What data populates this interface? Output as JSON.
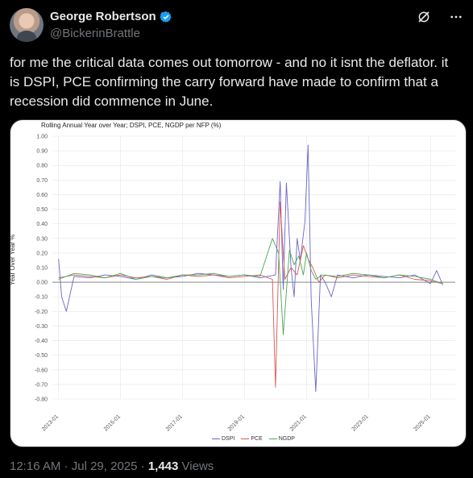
{
  "author": {
    "display_name": "George Robertson",
    "handle": "@BickerinBrattle",
    "avatar_icon": "user-avatar"
  },
  "tweet": {
    "text": "for me the critical data comes out tomorrow - and no it isnt the deflator. it is DSPI, PCE confirming the carry forward have made to confirm that a recession did commence in June."
  },
  "footer": {
    "time": "12:16 AM",
    "date": "Jul 29, 2025",
    "views_count": "1,443",
    "views_label": "Views"
  },
  "colors": {
    "dspi": "#6b64c9",
    "pce": "#d9574f",
    "ngdp": "#4aa85a",
    "verified": "#1d9bf0"
  },
  "chart_data": {
    "type": "line",
    "title": "Rolling Annual Year over Year; DSPI, PCE, NGDP per NFP (%)",
    "ylabel": "Year Over Year %",
    "xlabel": "",
    "ylim": [
      -0.8,
      1.0
    ],
    "xlim": [
      2012.8,
      2025.8
    ],
    "x_ticks": [
      "2013-01",
      "2015-01",
      "2017-01",
      "2019-01",
      "2021-01",
      "2023-01",
      "2025-01"
    ],
    "y_ticks": [
      "1.00",
      "0.90",
      "0.80",
      "0.70",
      "0.60",
      "0.50",
      "0.40",
      "0.30",
      "0.20",
      "0.10",
      "0.00",
      "-0.10",
      "-0.20",
      "-0.30",
      "-0.40",
      "-0.50",
      "-0.60",
      "-0.70",
      "-0.80"
    ],
    "legend": [
      "DSPI",
      "PCE",
      "NGDP"
    ],
    "series": [
      {
        "name": "DSPI",
        "points": [
          [
            2013.0,
            0.16
          ],
          [
            2013.1,
            -0.1
          ],
          [
            2013.25,
            -0.2
          ],
          [
            2013.5,
            0.04
          ],
          [
            2014.0,
            0.03
          ],
          [
            2014.5,
            0.05
          ],
          [
            2015.0,
            0.04
          ],
          [
            2015.5,
            0.02
          ],
          [
            2016.0,
            0.05
          ],
          [
            2016.5,
            0.03
          ],
          [
            2017.0,
            0.04
          ],
          [
            2017.5,
            0.06
          ],
          [
            2018.0,
            0.05
          ],
          [
            2018.5,
            0.04
          ],
          [
            2019.0,
            0.05
          ],
          [
            2019.5,
            0.03
          ],
          [
            2020.0,
            0.05
          ],
          [
            2020.15,
            0.69
          ],
          [
            2020.25,
            -0.05
          ],
          [
            2020.35,
            0.68
          ],
          [
            2020.5,
            0.1
          ],
          [
            2020.6,
            -0.1
          ],
          [
            2020.7,
            0.3
          ],
          [
            2020.8,
            0.15
          ],
          [
            2020.95,
            0.42
          ],
          [
            2021.05,
            0.94
          ],
          [
            2021.15,
            -0.12
          ],
          [
            2021.3,
            -0.75
          ],
          [
            2021.45,
            0.05
          ],
          [
            2021.6,
            0.0
          ],
          [
            2021.8,
            -0.1
          ],
          [
            2022.0,
            0.05
          ],
          [
            2022.5,
            0.03
          ],
          [
            2023.0,
            0.05
          ],
          [
            2023.5,
            0.04
          ],
          [
            2024.0,
            0.03
          ],
          [
            2024.5,
            0.05
          ],
          [
            2025.0,
            -0.01
          ],
          [
            2025.2,
            0.08
          ],
          [
            2025.4,
            -0.02
          ]
        ]
      },
      {
        "name": "PCE",
        "points": [
          [
            2013.0,
            0.03
          ],
          [
            2013.5,
            0.05
          ],
          [
            2014.0,
            0.04
          ],
          [
            2014.5,
            0.03
          ],
          [
            2015.0,
            0.05
          ],
          [
            2015.5,
            0.03
          ],
          [
            2016.0,
            0.04
          ],
          [
            2016.5,
            0.02
          ],
          [
            2017.0,
            0.05
          ],
          [
            2017.5,
            0.04
          ],
          [
            2018.0,
            0.05
          ],
          [
            2018.5,
            0.03
          ],
          [
            2019.0,
            0.04
          ],
          [
            2019.5,
            0.05
          ],
          [
            2019.9,
            0.02
          ],
          [
            2020.0,
            -0.72
          ],
          [
            2020.15,
            0.55
          ],
          [
            2020.3,
            0.02
          ],
          [
            2020.5,
            0.1
          ],
          [
            2020.7,
            0.05
          ],
          [
            2020.9,
            0.25
          ],
          [
            2021.05,
            0.16
          ],
          [
            2021.2,
            0.1
          ],
          [
            2021.4,
            0.0
          ],
          [
            2021.6,
            0.05
          ],
          [
            2022.0,
            0.03
          ],
          [
            2022.5,
            0.05
          ],
          [
            2023.0,
            0.04
          ],
          [
            2023.5,
            0.03
          ],
          [
            2024.0,
            0.05
          ],
          [
            2024.5,
            0.02
          ],
          [
            2025.0,
            0.01
          ],
          [
            2025.4,
            -0.01
          ]
        ]
      },
      {
        "name": "NGDP",
        "points": [
          [
            2013.0,
            0.02
          ],
          [
            2013.5,
            0.06
          ],
          [
            2014.0,
            0.05
          ],
          [
            2014.5,
            0.03
          ],
          [
            2015.0,
            0.06
          ],
          [
            2015.5,
            0.02
          ],
          [
            2016.0,
            0.04
          ],
          [
            2016.5,
            0.03
          ],
          [
            2017.0,
            0.05
          ],
          [
            2017.5,
            0.05
          ],
          [
            2018.0,
            0.06
          ],
          [
            2018.5,
            0.04
          ],
          [
            2019.0,
            0.05
          ],
          [
            2019.5,
            0.04
          ],
          [
            2019.9,
            0.3
          ],
          [
            2020.1,
            0.2
          ],
          [
            2020.25,
            -0.36
          ],
          [
            2020.45,
            0.22
          ],
          [
            2020.6,
            0.12
          ],
          [
            2020.75,
            0.18
          ],
          [
            2020.9,
            0.05
          ],
          [
            2021.0,
            0.2
          ],
          [
            2021.15,
            0.08
          ],
          [
            2021.3,
            0.02
          ],
          [
            2021.5,
            0.05
          ],
          [
            2022.0,
            0.04
          ],
          [
            2022.5,
            0.06
          ],
          [
            2023.0,
            0.05
          ],
          [
            2023.5,
            0.03
          ],
          [
            2024.0,
            0.05
          ],
          [
            2024.5,
            0.04
          ],
          [
            2025.0,
            0.02
          ],
          [
            2025.4,
            -0.01
          ]
        ]
      }
    ]
  }
}
